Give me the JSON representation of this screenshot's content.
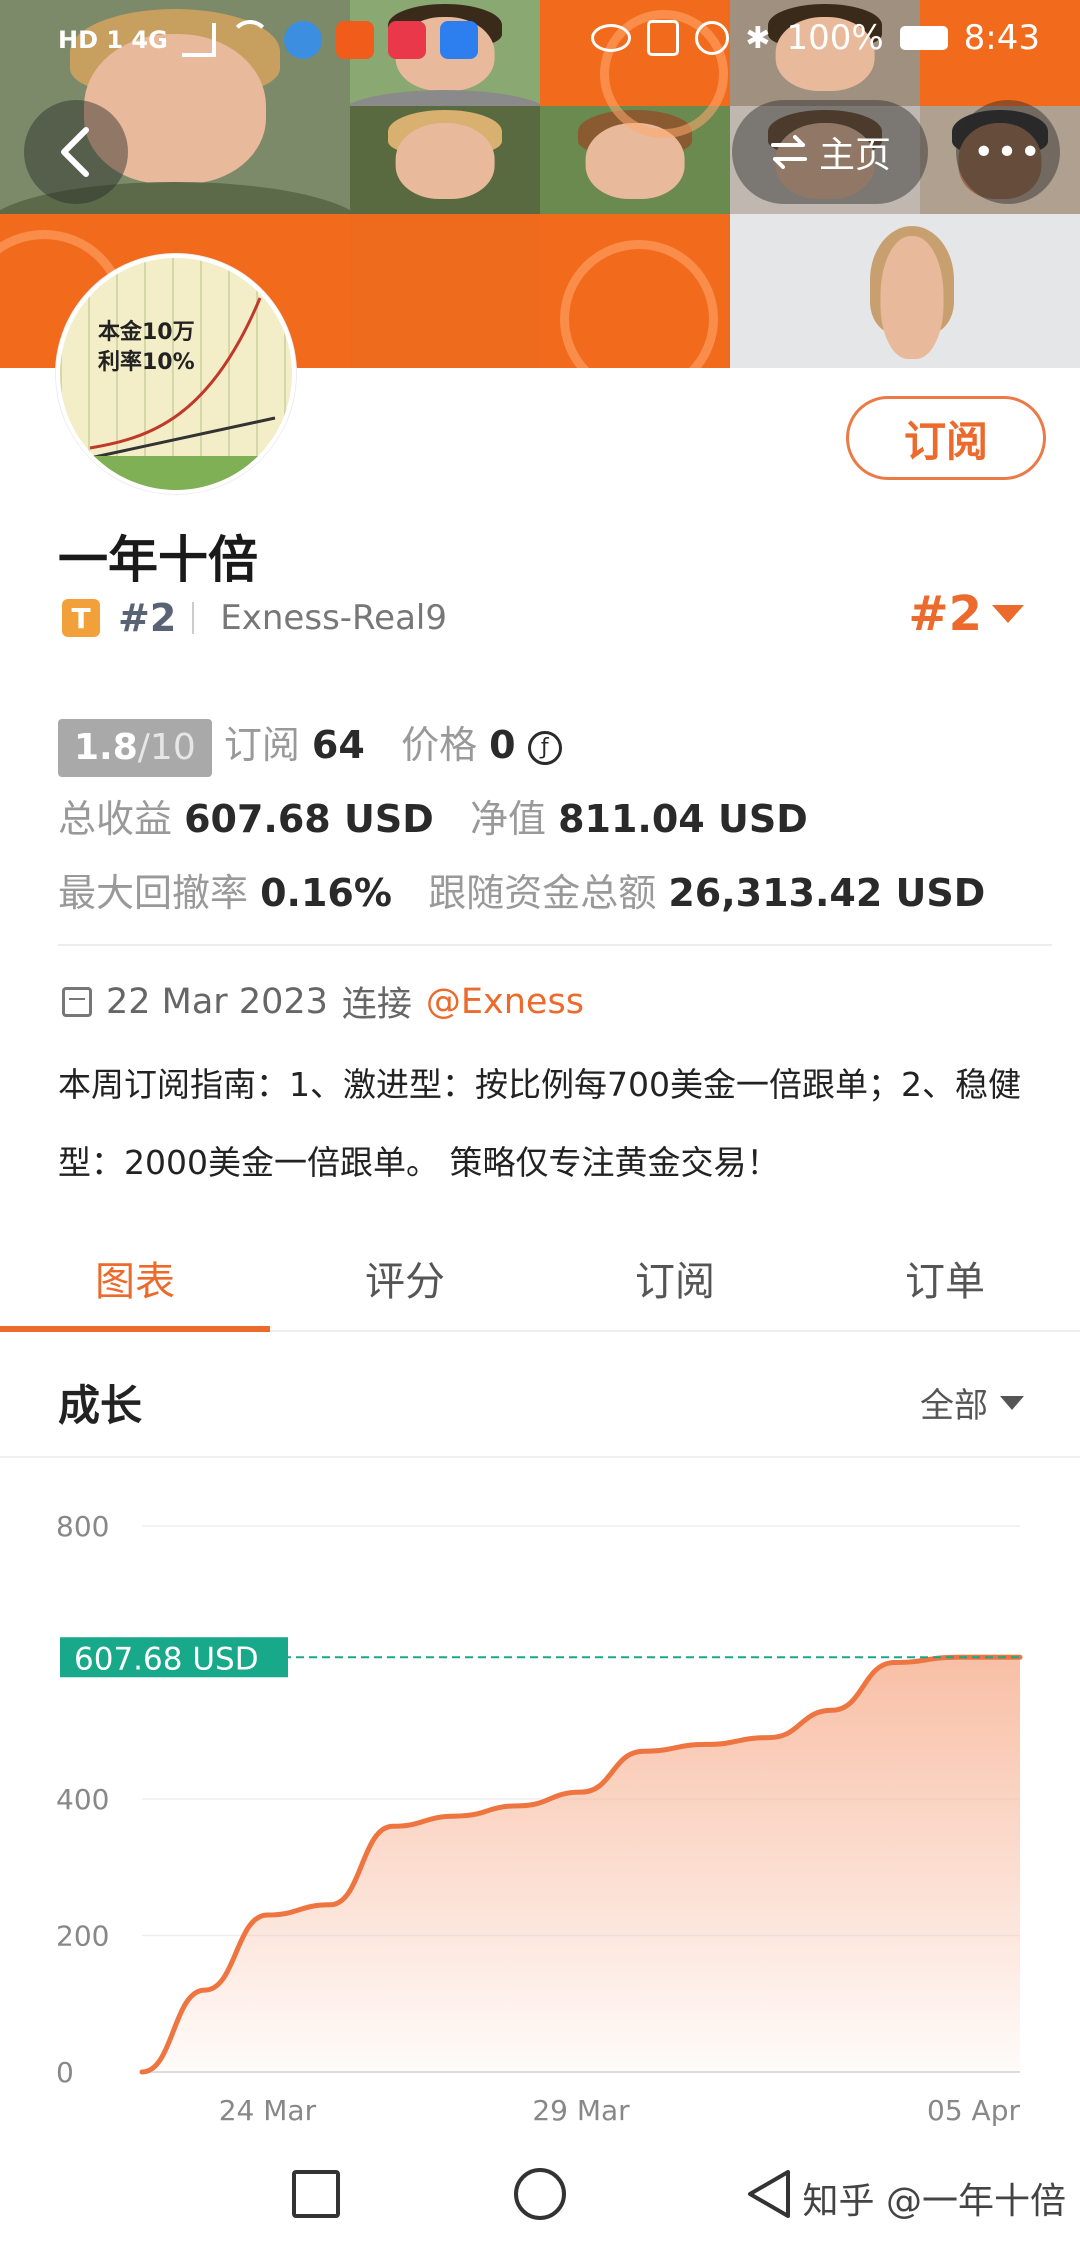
{
  "status_bar": {
    "left": "HD 1 4G",
    "battery": "100%",
    "time": "8:43"
  },
  "header": {
    "home_label": "主页",
    "more_label": "•••"
  },
  "avatar": {
    "line1": "本金10万",
    "line2": "利率10%"
  },
  "profile": {
    "subscribe_label": "订阅",
    "name": "一年十倍",
    "tier_badge": "T",
    "rank_small": "#2",
    "broker": "Exness-Real9",
    "rank_big": "#2"
  },
  "stats": {
    "score": "1.8",
    "score_max": "/10",
    "subscriptions_label": "订阅",
    "subscriptions": "64",
    "price_label": "价格",
    "price": "0",
    "price_icon": "coin-icon",
    "total_profit_label": "总收益",
    "total_profit": "607.68 USD",
    "equity_label": "净值",
    "equity": "811.04 USD",
    "max_drawdown_label": "最大回撤率",
    "max_drawdown": "0.16%",
    "follow_funds_label": "跟随资金总额",
    "follow_funds": "26,313.42 USD"
  },
  "connection": {
    "date": "22 Mar 2023",
    "connect_label": "连接",
    "broker_link": "@Exness"
  },
  "description": "本周订阅指南：1、激进型：按比例每700美金一倍跟单；2、稳健型：2000美金一倍跟单。 策略仅专注黄金交易！",
  "tabs": [
    {
      "label": "图表",
      "active": true
    },
    {
      "label": "评分",
      "active": false
    },
    {
      "label": "订阅",
      "active": false
    },
    {
      "label": "订单",
      "active": false
    }
  ],
  "section": {
    "title": "成长",
    "filter": "全部"
  },
  "chart_data": {
    "type": "area",
    "title": "",
    "y_ticks": [
      "0",
      "200",
      "400",
      "800"
    ],
    "ylim": [
      0,
      800
    ],
    "x_ticks": [
      "24 Mar",
      "29 Mar",
      "05 Apr"
    ],
    "current_value_label": "607.68 USD",
    "current_value": 607.68,
    "x": [
      "22 Mar",
      "23 Mar",
      "24 Mar",
      "25 Mar",
      "26 Mar",
      "27 Mar",
      "28 Mar",
      "29 Mar",
      "30 Mar",
      "31 Mar",
      "01 Apr",
      "02 Apr",
      "03 Apr",
      "04 Apr",
      "05 Apr"
    ],
    "values": [
      0,
      120,
      230,
      245,
      360,
      375,
      390,
      410,
      470,
      480,
      490,
      530,
      600,
      607.68,
      607.68
    ],
    "line_color": "#ee7440",
    "fill_color": "#f7b496",
    "marker_color": "#18a88a",
    "grid": true
  },
  "watermark": "知乎 @一年十倍"
}
